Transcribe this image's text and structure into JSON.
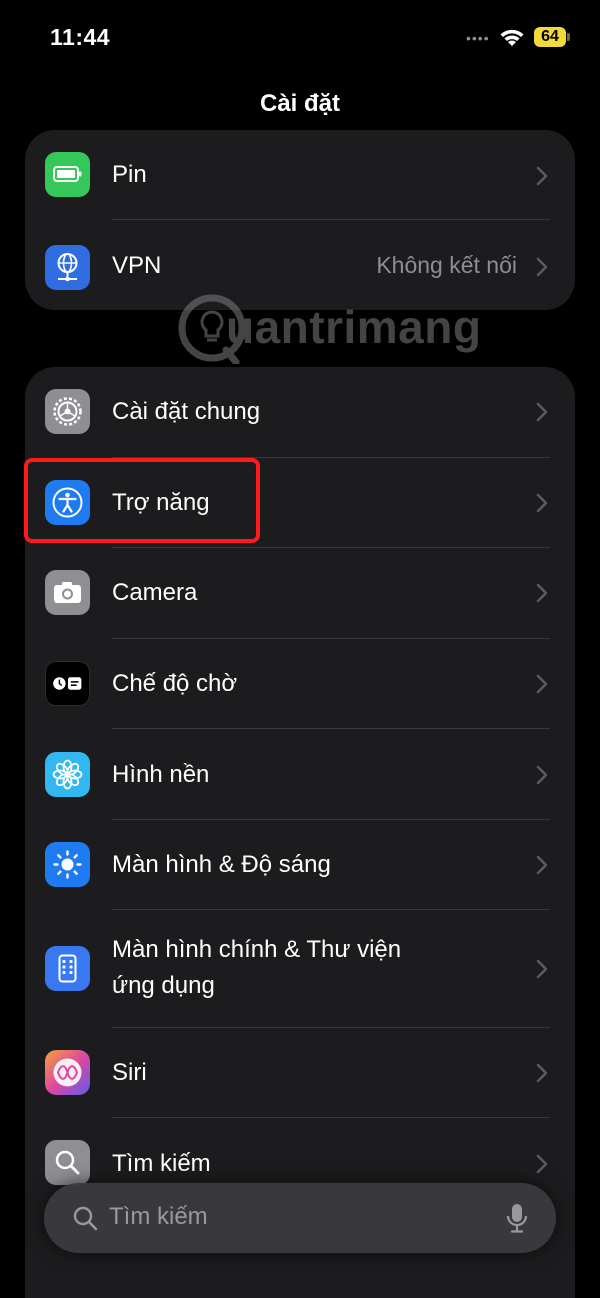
{
  "status_bar": {
    "time": "11:44",
    "battery": "64"
  },
  "header": {
    "title": "Cài đặt"
  },
  "group1": [
    {
      "label": "Pin",
      "value": "",
      "icon": "battery-icon",
      "color": "#34c759"
    },
    {
      "label": "VPN",
      "value": "Không kết nối",
      "icon": "globe-network-icon",
      "color": "#2f6de1"
    }
  ],
  "group2": [
    {
      "label": "Cài đặt chung",
      "icon": "gear-icon",
      "color": "#8e8e93"
    },
    {
      "label": "Trợ năng",
      "icon": "accessibility-icon",
      "color": "#1f7bf2"
    },
    {
      "label": "Camera",
      "icon": "camera-icon",
      "color": "#8e8e93"
    },
    {
      "label": "Chế độ chờ",
      "icon": "standby-icon",
      "color": "#000000"
    },
    {
      "label": "Hình nền",
      "icon": "wallpaper-flower-icon",
      "color": "#33b7f0"
    },
    {
      "label": "Màn hình & Độ sáng",
      "icon": "brightness-icon",
      "color": "#1f7bf2"
    },
    {
      "label": "Màn hình chính & Thư viện",
      "label2": "ứng dụng",
      "icon": "home-screen-icon",
      "color": "#3a78f2"
    },
    {
      "label": "Siri",
      "icon": "siri-icon",
      "color": "#e0479e"
    },
    {
      "label": "Tìm kiếm",
      "icon": "search-icon",
      "color": "#8e8e93"
    }
  ],
  "watermark": {
    "text": "uantrimang"
  },
  "search_bar": {
    "placeholder": "Tìm kiếm"
  }
}
